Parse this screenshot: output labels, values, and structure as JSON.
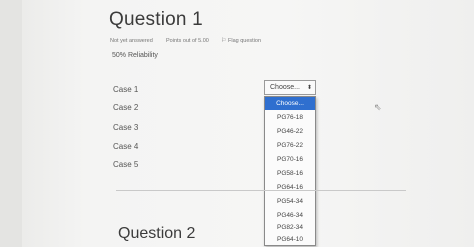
{
  "question1": {
    "title": "Question 1",
    "status": "Not yet answered",
    "points": "Points out of 5.00",
    "flag_label": "Flag question",
    "prompt": "50% Reliability"
  },
  "cases": [
    "Case 1",
    "Case 2",
    "Case 3",
    "Case 4",
    "Case 5"
  ],
  "select": {
    "value": "Choose...",
    "arrow": "⬍"
  },
  "dropdown_options": [
    "Choose...",
    "PG76-18",
    "PG46-22",
    "PG76-22",
    "PG70-16",
    "PG58-16",
    "PG64-16",
    "PG54-34",
    "PG46-34",
    "PG82-34",
    "PG64-10"
  ],
  "icons": {
    "flag": "⚐",
    "cursor": "⇖"
  },
  "question2": {
    "title": "Question 2"
  },
  "colors": {
    "highlight": "#2f6fcf"
  }
}
